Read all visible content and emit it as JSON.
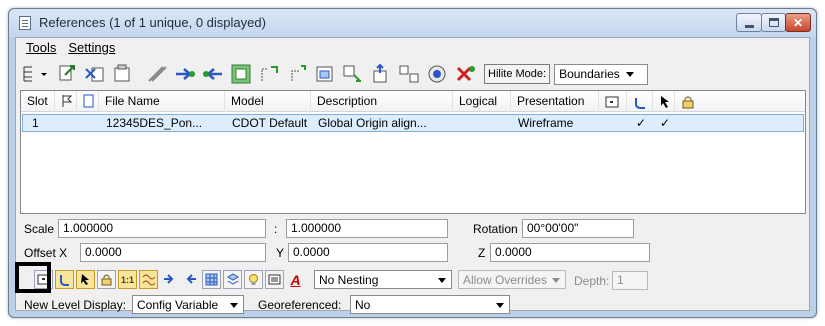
{
  "window": {
    "title": "References (1 of 1 unique, 0 displayed)",
    "close_glyph": "✕"
  },
  "menu": {
    "tools": "Tools",
    "settings": "Settings"
  },
  "toolbar": {
    "hilite_label": "Hilite Mode:",
    "hilite_value": "Boundaries"
  },
  "table": {
    "columns": [
      "Slot",
      "File Name",
      "Model",
      "Description",
      "Logical",
      "Presentation"
    ],
    "rows": [
      {
        "slot": "1",
        "file_name": "12345DES_Pon...",
        "model": "CDOT Default",
        "description": "Global Origin align...",
        "logical": "",
        "presentation": "Wireframe",
        "check1": "✓",
        "check2": "✓"
      }
    ]
  },
  "settings": {
    "scale_label": "Scale",
    "scale_a": "1.000000",
    "colon": ":",
    "scale_b": "1.000000",
    "rotation_label": "Rotation",
    "rotation_value": "00°00'00\"",
    "offset_label": "Offset X",
    "offset_x": "0.0000",
    "y_label": "Y",
    "offset_y": "0.0000",
    "z_label": "Z",
    "offset_z": "0.0000",
    "nesting_value": "No Nesting",
    "overrides_value": "Allow Overrides",
    "depth_label": "Depth:",
    "depth_value": "1",
    "scale_btn_label": "1:1",
    "underline_a": "A",
    "new_level_label": "New Level Display:",
    "new_level_value": "Config Variable",
    "georef_label": "Georeferenced:",
    "georef_value": "No"
  },
  "colors": {
    "title_gradient_top": "#dbe7f6",
    "selection": "#dceefd",
    "close_button": "#c7442a"
  }
}
